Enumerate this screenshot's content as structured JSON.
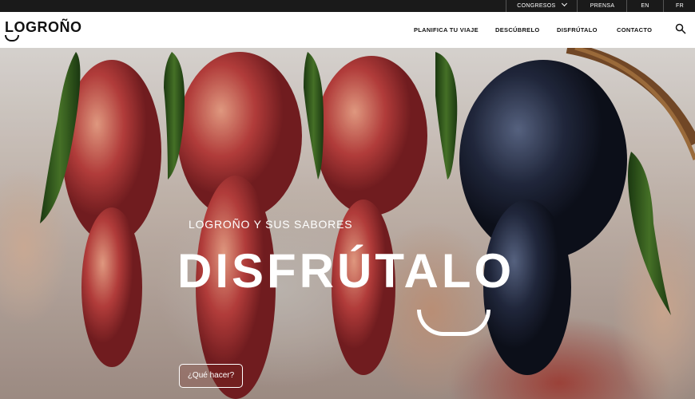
{
  "topbar": {
    "congresos": "CONGRESOS",
    "prensa": "PRENSA",
    "en": "EN",
    "fr": "FR"
  },
  "header": {
    "logo": "LOGROÑO",
    "nav": [
      "PLANIFICA TU VIAJE",
      "DESCÚBRELO",
      "DISFRÚTALO",
      "CONTACTO"
    ]
  },
  "hero": {
    "subtitle": "LOGROÑO Y SUS SABORES",
    "title": "DISFRÚTALO",
    "cta": "¿Qué hacer?"
  },
  "colors": {
    "topbar_bg": "#1a1a1a",
    "header_bg": "#ffffff",
    "accent_red_grape": "#b8323f",
    "accent_dark_grape": "#1e2233",
    "accent_pepper_green": "#2f5a1f"
  }
}
